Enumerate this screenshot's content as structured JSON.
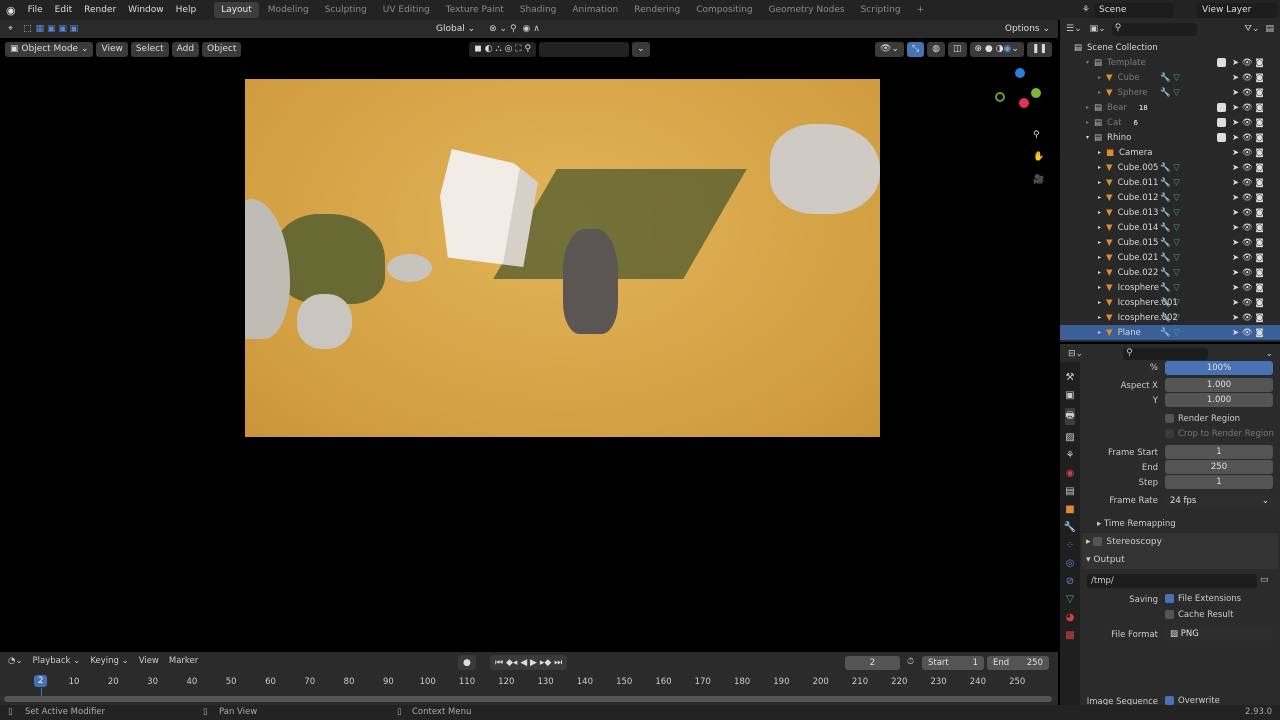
{
  "menu": {
    "items": [
      "File",
      "Edit",
      "Render",
      "Window",
      "Help"
    ]
  },
  "workspaces": [
    "Layout",
    "Modeling",
    "Sculpting",
    "UV Editing",
    "Texture Paint",
    "Shading",
    "Animation",
    "Rendering",
    "Compositing",
    "Geometry Nodes",
    "Scripting",
    "+"
  ],
  "active_workspace": "Layout",
  "scene": "Scene",
  "view_layer": "View Layer",
  "toolheader": {
    "orientation": "Global",
    "options": "Options"
  },
  "viewport_header": {
    "mode": "Object Mode",
    "menus": [
      "View",
      "Select",
      "Add",
      "Object"
    ]
  },
  "outliner": {
    "root": "Scene Collection",
    "rows": [
      {
        "name": "Template",
        "indent": 1,
        "type": "collection",
        "dim": true,
        "check": true
      },
      {
        "name": "Cube",
        "indent": 2,
        "type": "mesh",
        "dim": true
      },
      {
        "name": "Sphere",
        "indent": 2,
        "type": "mesh",
        "dim": true
      },
      {
        "name": "Bear",
        "indent": 1,
        "type": "collection",
        "dim": true,
        "check": true,
        "badge": "18"
      },
      {
        "name": "Cat",
        "indent": 1,
        "type": "collection",
        "dim": true,
        "check": true,
        "badge": "6"
      },
      {
        "name": "Rhino",
        "indent": 1,
        "type": "collection",
        "check": true
      },
      {
        "name": "Camera",
        "indent": 2,
        "type": "camera"
      },
      {
        "name": "Cube.005",
        "indent": 2,
        "type": "mesh"
      },
      {
        "name": "Cube.011",
        "indent": 2,
        "type": "mesh"
      },
      {
        "name": "Cube.012",
        "indent": 2,
        "type": "mesh"
      },
      {
        "name": "Cube.013",
        "indent": 2,
        "type": "mesh"
      },
      {
        "name": "Cube.014",
        "indent": 2,
        "type": "mesh"
      },
      {
        "name": "Cube.015",
        "indent": 2,
        "type": "mesh"
      },
      {
        "name": "Cube.021",
        "indent": 2,
        "type": "mesh"
      },
      {
        "name": "Cube.022",
        "indent": 2,
        "type": "mesh"
      },
      {
        "name": "Icosphere",
        "indent": 2,
        "type": "mesh"
      },
      {
        "name": "Icosphere.001",
        "indent": 2,
        "type": "mesh"
      },
      {
        "name": "Icosphere.002",
        "indent": 2,
        "type": "mesh"
      },
      {
        "name": "Plane",
        "indent": 2,
        "type": "mesh",
        "selected": true
      }
    ]
  },
  "properties": {
    "resolution_pct_label": "%",
    "resolution_pct": "100%",
    "aspect_x_label": "Aspect X",
    "aspect_x": "1.000",
    "aspect_y_label": "Y",
    "aspect_y": "1.000",
    "render_region": "Render Region",
    "crop_region": "Crop to Render Region",
    "frame_start_label": "Frame Start",
    "frame_start": "1",
    "end_label": "End",
    "end": "250",
    "step_label": "Step",
    "step": "1",
    "frame_rate_label": "Frame Rate",
    "frame_rate": "24 fps",
    "time_remapping": "Time Remapping",
    "stereoscopy": "Stereoscopy",
    "output": "Output",
    "output_path": "/tmp/",
    "saving_label": "Saving",
    "file_extensions": "File Extensions",
    "cache_result": "Cache Result",
    "file_format_label": "File Format",
    "file_format": "PNG",
    "overwrite_label": "Image Sequence",
    "overwrite": "Overwrite"
  },
  "timeline": {
    "menus": [
      "Playback",
      "Keying",
      "View",
      "Marker"
    ],
    "current_frame": "2",
    "start_label": "Start",
    "start": "1",
    "end_label": "End",
    "end": "250",
    "ticks": [
      "10",
      "20",
      "30",
      "40",
      "50",
      "60",
      "70",
      "80",
      "90",
      "100",
      "110",
      "120",
      "130",
      "140",
      "150",
      "160",
      "170",
      "180",
      "190",
      "200",
      "210",
      "220",
      "230",
      "240",
      "250"
    ]
  },
  "status": {
    "left": "Set Active Modifier",
    "middle": "Pan View",
    "right": "Context Menu",
    "version": "2.93.0"
  }
}
